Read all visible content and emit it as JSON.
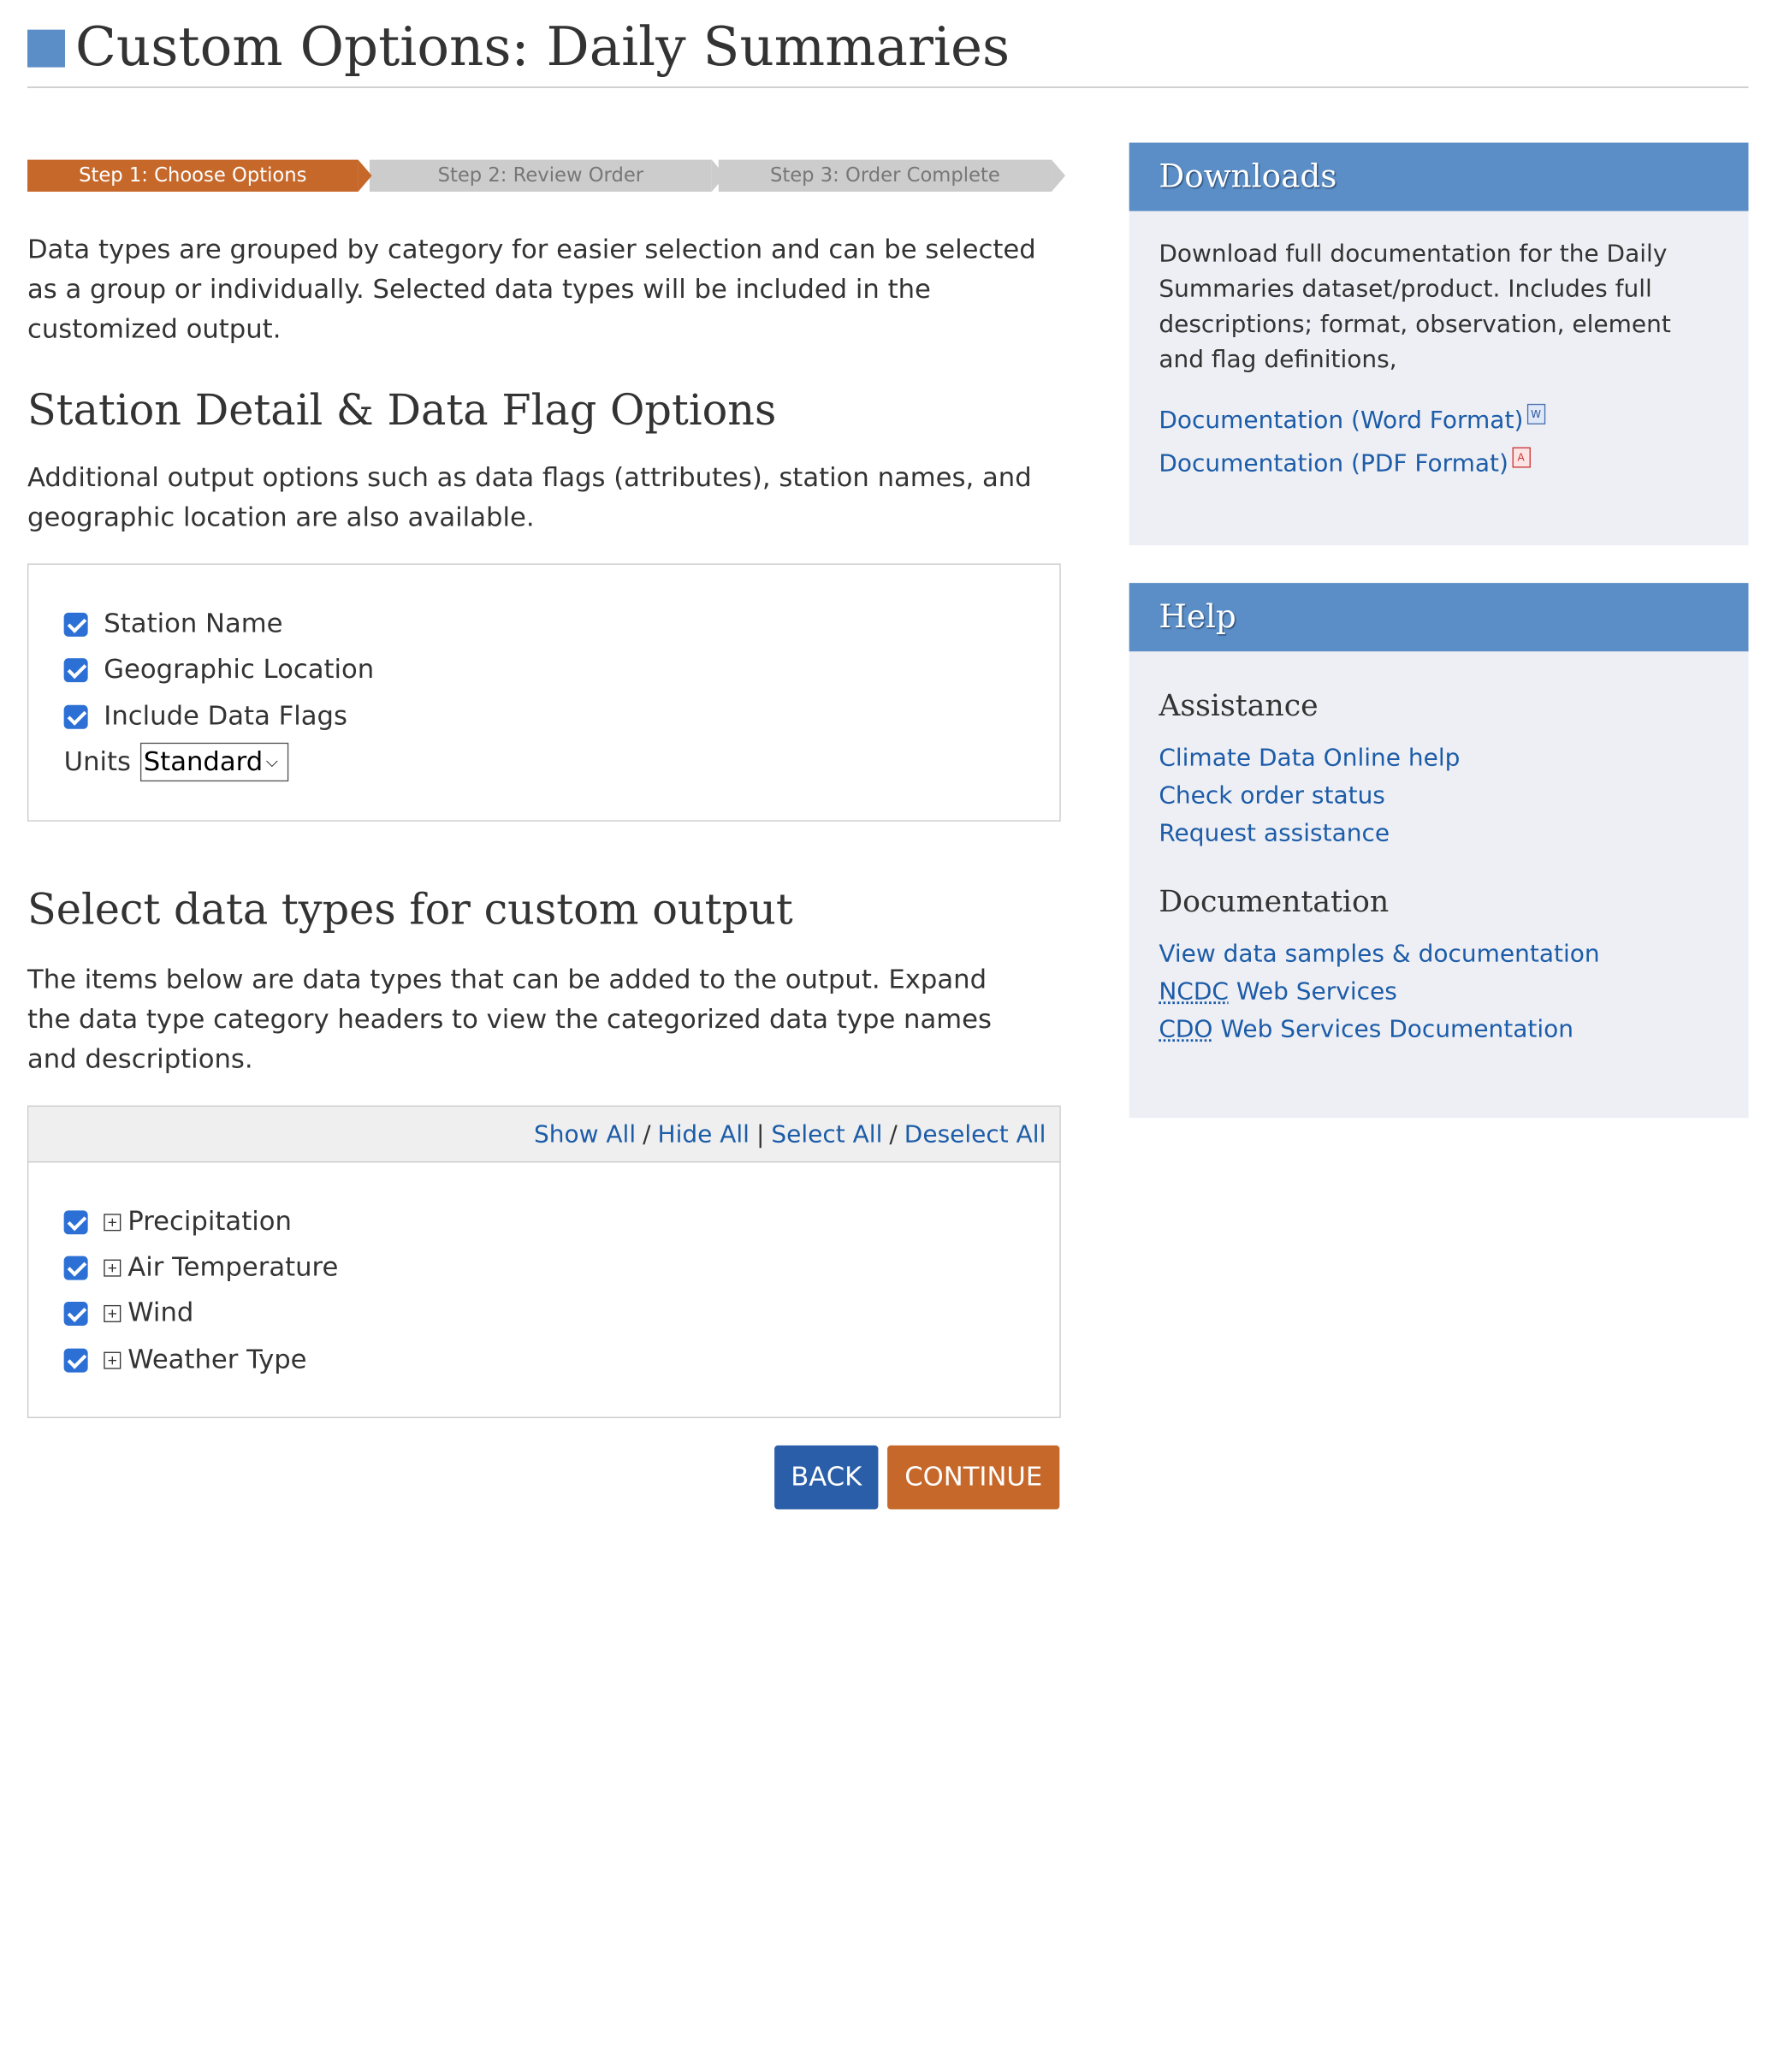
{
  "page": {
    "title": "Custom Options: Daily Summaries"
  },
  "steps": [
    {
      "label": "Step 1: Choose Options",
      "active": true
    },
    {
      "label": "Step 2: Review Order",
      "active": false
    },
    {
      "label": "Step 3: Order Complete",
      "active": false
    }
  ],
  "intro": "Data types are grouped by category for easier selection and can be selected as a group or individually. Selected data types will be included in the customized output.",
  "station_section": {
    "heading": "Station Detail & Data Flag Options",
    "description": "Additional output options such as data flags (attributes), station names, and geographic location are also available.",
    "options": [
      {
        "label": "Station Name",
        "checked": true
      },
      {
        "label": "Geographic Location",
        "checked": true
      },
      {
        "label": "Include Data Flags",
        "checked": true
      }
    ],
    "units_label": "Units",
    "units_value": "Standard"
  },
  "datatypes_section": {
    "heading": "Select data types for custom output",
    "description": "The items below are data types that can be added to the output. Expand the data type category headers to view the categorized data type names and descriptions.",
    "controls": {
      "show_all": "Show All",
      "hide_all": "Hide All",
      "select_all": "Select All",
      "deselect_all": "Deselect All"
    },
    "categories": [
      {
        "label": "Precipitation",
        "checked": true
      },
      {
        "label": "Air Temperature",
        "checked": true
      },
      {
        "label": "Wind",
        "checked": true
      },
      {
        "label": "Weather Type",
        "checked": true
      }
    ]
  },
  "buttons": {
    "back": "BACK",
    "continue": "CONTINUE"
  },
  "downloads": {
    "title": "Downloads",
    "text": "Download full documentation for the Daily Summaries dataset/product. Includes full descriptions; format, observation, element and flag definitions,",
    "word_link": "Documentation (Word Format)",
    "pdf_link": "Documentation (PDF Format)"
  },
  "help": {
    "title": "Help",
    "assistance_heading": "Assistance",
    "assistance_links": [
      "Climate Data Online help",
      "Check order status",
      "Request assistance"
    ],
    "documentation_heading": "Documentation",
    "doc_link_1": "View data samples & documentation",
    "ncdc_abbr": "NCDC",
    "ncdc_rest": " Web Services",
    "cdo_abbr": "CDO",
    "cdo_rest": " Web Services Documentation"
  },
  "colors": {
    "accent_orange": "#c7682b",
    "accent_blue": "#5b8ec6",
    "link": "#1c5ca8"
  }
}
